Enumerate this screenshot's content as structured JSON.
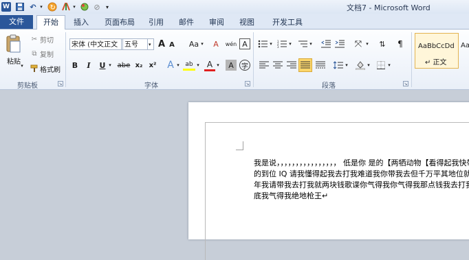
{
  "titlebar": {
    "app_logo": "W",
    "title": "文档7 - Microsoft Word"
  },
  "tabs": {
    "file": "文件",
    "home": "开始",
    "insert": "插入",
    "page_layout": "页面布局",
    "references": "引用",
    "mailings": "邮件",
    "review": "审阅",
    "view": "视图",
    "developer": "开发工具"
  },
  "clipboard": {
    "paste": "粘贴",
    "cut": "剪切",
    "copy": "复制",
    "format_painter": "格式刷",
    "label": "剪贴板"
  },
  "font": {
    "family": "宋体 (中文正文",
    "size": "五号",
    "grow": "A",
    "shrink": "A",
    "case": "Aa",
    "clear": "A",
    "phonetic": "wén",
    "char_border": "A",
    "bold": "B",
    "italic": "I",
    "underline": "U",
    "strike": "abe",
    "subscript": "x₂",
    "superscript": "x²",
    "effects": "A",
    "highlight": "ab",
    "font_color": "A",
    "char_shading": "A",
    "enclosed": "字",
    "label": "字体"
  },
  "paragraph": {
    "label": "段落"
  },
  "styles": {
    "style1_preview": "AaBbCcDd",
    "style1_name": "↵ 正文",
    "style2_preview": "Aa"
  },
  "document": {
    "lines": [
      "我是说，，，，，，，，，，，，，，，， 低是你 是的【两牺动物【看得起我快带我",
      "的到位 IQ 请我懂得起我去打我难道我你带我去但千万平其地位就的",
      "年我请带我去打我就两块钱歌谍你气得我你气得我那点钱我去打我",
      "底我气得我绝地枪王↵"
    ]
  },
  "colors": {
    "file_tab": "#2b579a",
    "highlight": "#ffff00",
    "font_color": "#e02020"
  }
}
